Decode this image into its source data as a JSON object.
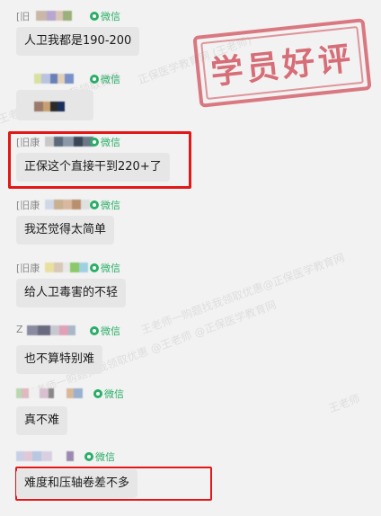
{
  "platform_label": "微信",
  "messages": [
    {
      "sender_prefix": "[旧",
      "text": "人卫我都是190-200",
      "highlighted": false
    },
    {
      "sender_prefix": "",
      "text": "",
      "highlighted": false
    },
    {
      "sender_prefix": "[旧康",
      "text": "正保这个直接干到220+了",
      "highlighted": true
    },
    {
      "sender_prefix": "[旧康",
      "text": "我还觉得太简单",
      "highlighted": false
    },
    {
      "sender_prefix": "[旧康",
      "text": "给人卫毒害的不轻",
      "highlighted": false
    },
    {
      "sender_prefix": "Z",
      "text": "也不算特别难",
      "highlighted": false
    },
    {
      "sender_prefix": "",
      "text": "真不难",
      "highlighted": false
    },
    {
      "sender_prefix": "",
      "text": "难度和压轴卷差不多",
      "highlighted": true
    }
  ],
  "stamp": {
    "text": "学员好评"
  },
  "watermarks": [
    "正保医学教育网 (王老师)",
    "王老师一购题找我领取优惠",
    "王老师一购题找我领取优惠@正保医学教育网",
    "王老师一购题找我领取优惠 @王老师 @正保医学教育网",
    "王老师"
  ],
  "colors": {
    "background": "#f2f2f2",
    "bubble": "#e6e6e6",
    "wechat_green": "#2aae67",
    "highlight_red": "#e21717",
    "stamp_red": "#ce4854"
  }
}
